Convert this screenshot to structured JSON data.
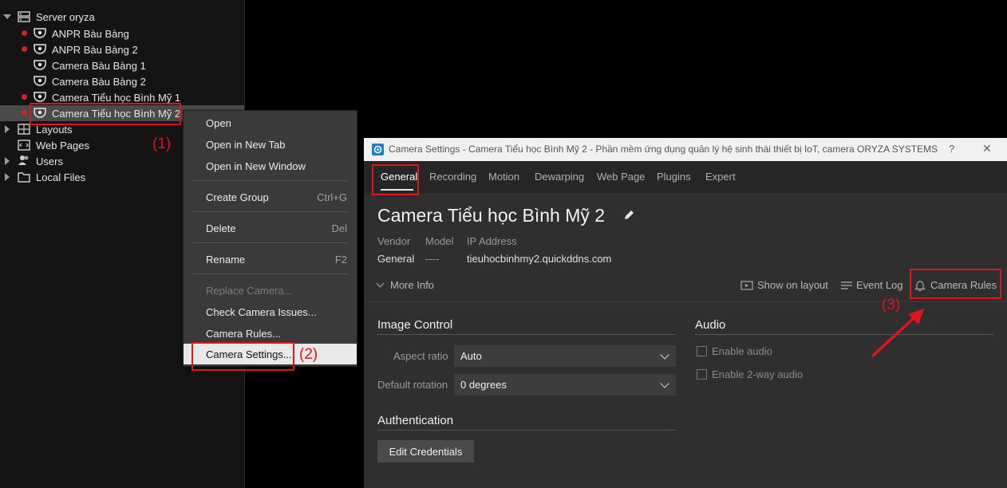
{
  "tree": {
    "root": "Server oryza",
    "cameras": [
      {
        "label": "ANPR Bàu Bàng",
        "recording": true
      },
      {
        "label": "ANPR Bàu Bàng 2",
        "recording": true
      },
      {
        "label": "Camera Bàu Bàng 1",
        "recording": false
      },
      {
        "label": "Camera Bàu Bàng 2",
        "recording": false
      },
      {
        "label": "Camera Tiểu học Bình Mỹ 1",
        "recording": true
      },
      {
        "label": "Camera Tiểu học Bình Mỹ 2",
        "recording": true,
        "selected": true
      }
    ],
    "groups": [
      "Layouts",
      "Web Pages",
      "Users",
      "Local Files"
    ]
  },
  "context_menu": {
    "items": [
      {
        "label": "Open",
        "shortcut": ""
      },
      {
        "label": "Open in New Tab",
        "shortcut": ""
      },
      {
        "label": "Open in New Window",
        "shortcut": ""
      },
      {
        "label": "Create Group",
        "shortcut": "Ctrl+G"
      },
      {
        "label": "Delete",
        "shortcut": "Del"
      },
      {
        "label": "Rename",
        "shortcut": "F2"
      },
      {
        "label": "Replace Camera...",
        "shortcut": "",
        "disabled": true
      },
      {
        "label": "Check Camera Issues...",
        "shortcut": ""
      },
      {
        "label": "Camera Rules...",
        "shortcut": ""
      },
      {
        "label": "Camera Settings...",
        "shortcut": "",
        "highlighted": true
      }
    ]
  },
  "annotations": {
    "step1": "(1)",
    "step2": "(2)",
    "step3": "(3)",
    "color": "#e0151b"
  },
  "dialog": {
    "title": "Camera Settings - Camera Tiểu học Bình Mỹ 2 - Phần mềm ứng dụng quản lý hệ sinh thái thiết bị IoT, camera ORYZA SYSTEMS",
    "help": "?",
    "close": "✕",
    "tabs": [
      "General",
      "Recording",
      "Motion",
      "Dewarping",
      "Web Page",
      "Plugins",
      "Expert"
    ],
    "active_tab": "General",
    "camera_name": "Camera Tiểu học Bình Mỹ 2",
    "info": {
      "vendor_label": "Vendor",
      "vendor_value": "General",
      "model_label": "Model",
      "model_value": "----",
      "ip_label": "IP Address",
      "ip_value": "tieuhocbinhmy2.quickddns.com"
    },
    "more_info": "More Info",
    "actions": {
      "show_on_layout": "Show on layout",
      "event_log": "Event Log",
      "camera_rules": "Camera Rules"
    },
    "image_control": {
      "title": "Image Control",
      "aspect_ratio_label": "Aspect ratio",
      "aspect_ratio_value": "Auto",
      "rotation_label": "Default rotation",
      "rotation_value": "0 degrees"
    },
    "audio": {
      "title": "Audio",
      "enable_audio": "Enable audio",
      "enable_2way": "Enable 2-way audio"
    },
    "authentication": {
      "title": "Authentication",
      "edit_credentials": "Edit Credentials"
    }
  },
  "colors": {
    "accent_red": "#e0151b",
    "record_dot": "#d9202a",
    "panel_bg": "#2f2f2f"
  }
}
